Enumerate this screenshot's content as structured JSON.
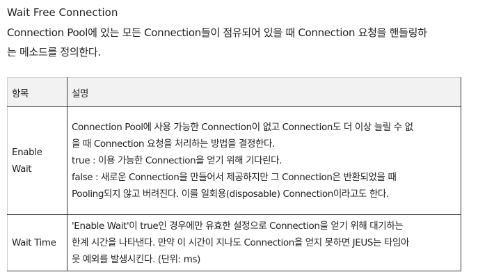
{
  "section_title": "Wait Free Connection",
  "intro_lines": [
    "Connection Pool에 있는 모든 Connection들이 점유되어 있을 때 Connection 요청을 핸들링하",
    "는 메소드를 정의한다."
  ],
  "table": {
    "headers": [
      "항목",
      "설명"
    ],
    "rows": [
      {
        "item_lines": [
          "Enable",
          "Wait"
        ],
        "desc_lines": [
          "Connection Pool에 사용 가능한 Connection이 없고 Connection도 더 이상 늘릴 수 없",
          "을 때 Connection 요청을 처리하는 방법을 결정한다.",
          "true : 이용 가능한 Connection을 얻기 위해 기다린다.",
          "false : 새로운 Connection을 만들어서 제공하지만 그 Connection은 반환되었을 때",
          "Pooling되지 않고 버려진다. 이를 일회용(disposable) Connection이라고도 한다."
        ]
      },
      {
        "item_lines": [
          "Wait Time"
        ],
        "desc_lines": [
          "'Enable Wait'이 true인 경우에만 유효한 설정으로 Connection을 얻기 위해 대기하는",
          "한계 시간을 나타낸다. 만약 이 시간이 지나도 Connection을 얻지 못하면 JEUS는 타임아",
          "웃 예외를 발생시킨다. (단위: ms)"
        ]
      }
    ]
  }
}
